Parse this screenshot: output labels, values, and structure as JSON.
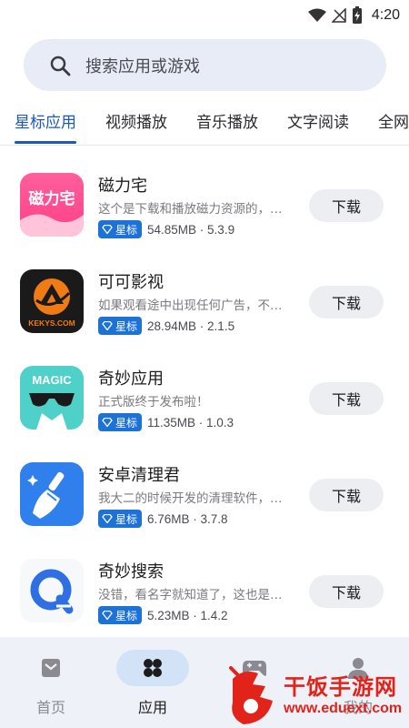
{
  "status_bar": {
    "time": "4:20"
  },
  "search": {
    "placeholder": "搜索应用或游戏"
  },
  "tabs": [
    {
      "label": "星标应用",
      "active": true
    },
    {
      "label": "视频播放"
    },
    {
      "label": "音乐播放"
    },
    {
      "label": "文字阅读"
    },
    {
      "label": "全网"
    }
  ],
  "apps": [
    {
      "name": "磁力宅",
      "desc": "这个是下载和播放磁力资源的，…",
      "badge": "星标",
      "meta": "54.85MB · 5.3.9",
      "icon": "cilizhai-app-icon",
      "icon_text": "磁力宅",
      "button": "下载"
    },
    {
      "name": "可可影视",
      "desc": "如果观看途中出现任何广告，不…",
      "badge": "星标",
      "meta": "28.94MB · 2.1.5",
      "icon": "kekys-app-icon",
      "icon_text": "KEKYS.COM",
      "button": "下载"
    },
    {
      "name": "奇妙应用",
      "desc": "正式版终于发布啦！",
      "badge": "星标",
      "meta": "11.35MB · 1.0.3",
      "icon": "magic-app-icon",
      "icon_text": "MAGIC",
      "button": "下载"
    },
    {
      "name": "安卓清理君",
      "desc": "我大二的时候开发的清理软件，…",
      "badge": "星标",
      "meta": "6.76MB · 3.7.8",
      "icon": "broom-app-icon",
      "button": "下载"
    },
    {
      "name": "奇妙搜索",
      "desc": "没错，看名字就知道了，这也是…",
      "badge": "星标",
      "meta": "5.23MB · 1.4.2",
      "icon": "search-q-app-icon",
      "button": "下载"
    }
  ],
  "bottom_nav": [
    {
      "label": "首页",
      "icon": "home-icon"
    },
    {
      "label": "应用",
      "icon": "apps-icon",
      "active": true
    },
    {
      "label": "",
      "icon": "gamepad-icon"
    },
    {
      "label": "我的",
      "icon": "person-icon"
    }
  ],
  "watermark": {
    "title": "干饭手游网",
    "url": "www.eduext.com"
  },
  "colors": {
    "accent": "#1d56c2",
    "badge": "#1d72d8",
    "search_bg": "#e8ecf6",
    "nav_bg": "#eef1f8",
    "watermark": "#e2231a"
  }
}
